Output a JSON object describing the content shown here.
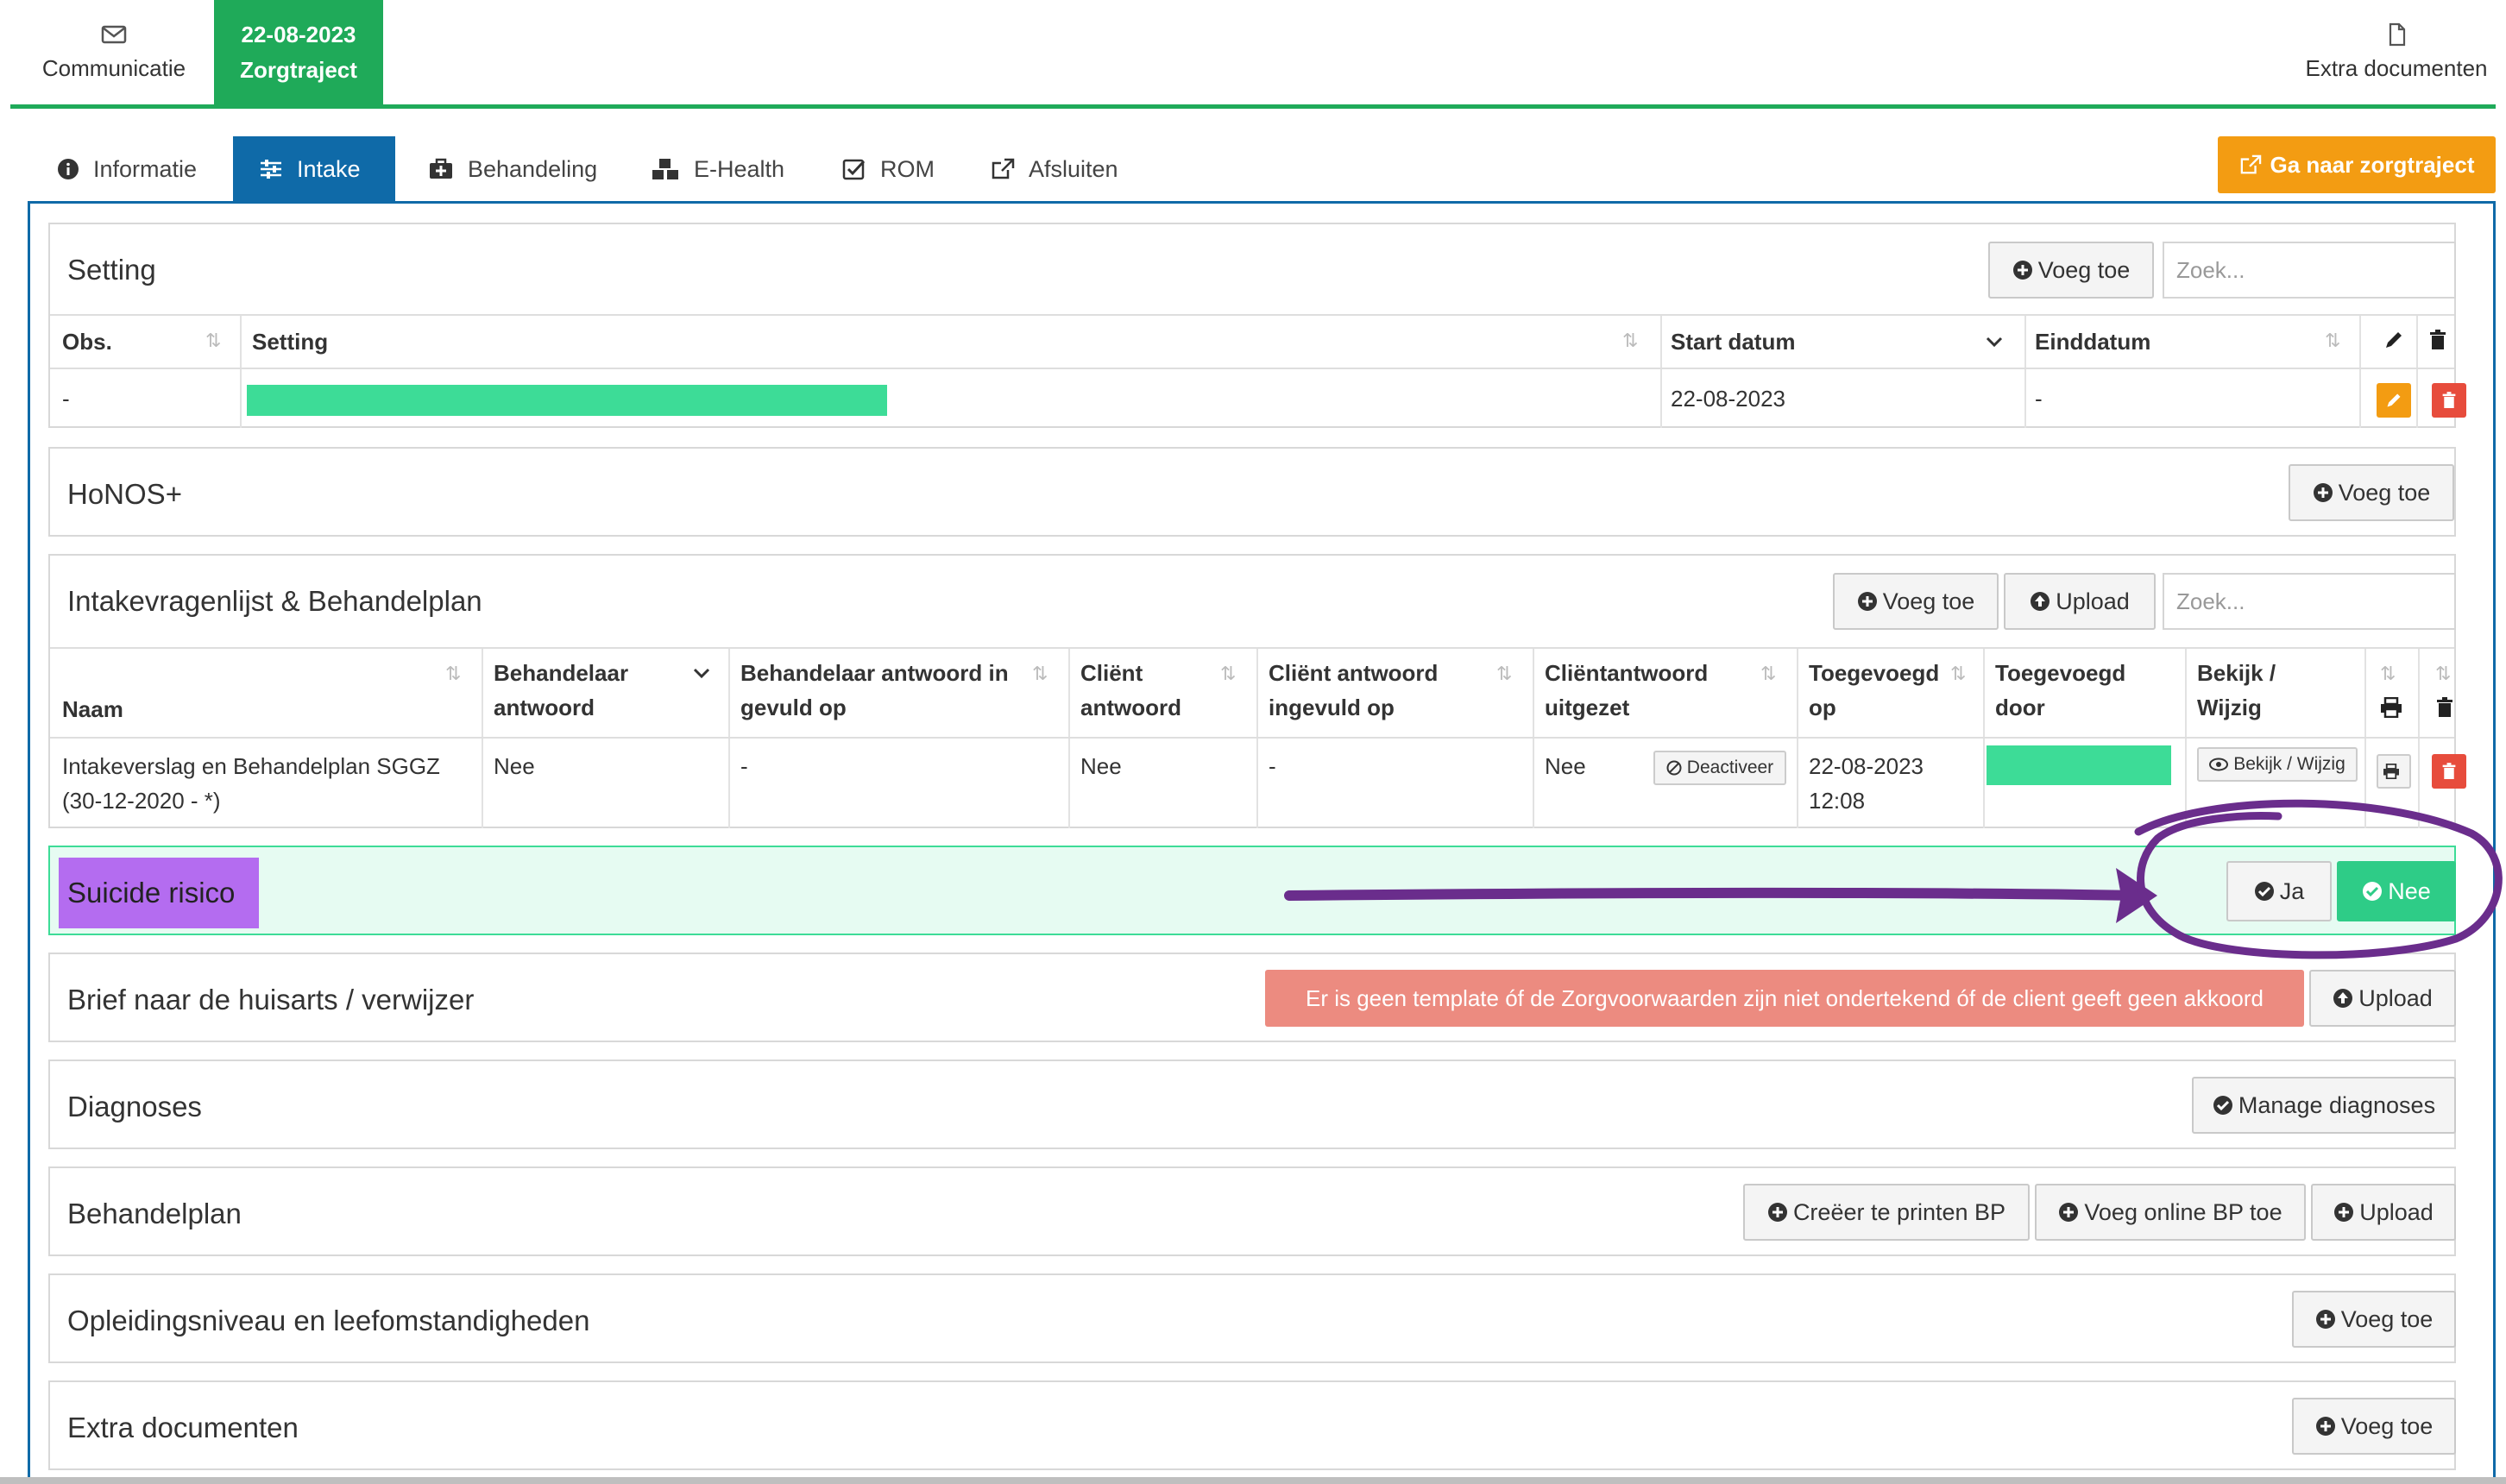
{
  "top_tabs": {
    "communicatie": "Communicatie",
    "zorgtraject_date": "22-08-2023",
    "zorgtraject": "Zorgtraject",
    "extra_documenten": "Extra documenten"
  },
  "sub_tabs": [
    {
      "label": "Informatie",
      "icon": "info-icon"
    },
    {
      "label": "Intake",
      "icon": "sliders-icon"
    },
    {
      "label": "Behandeling",
      "icon": "medkit-icon"
    },
    {
      "label": "E-Health",
      "icon": "cubes-icon"
    },
    {
      "label": "ROM",
      "icon": "check-square-icon"
    },
    {
      "label": "Afsluiten",
      "icon": "external-link-icon"
    }
  ],
  "go_button": "Ga naar zorgtraject",
  "setting": {
    "title": "Setting",
    "add": "Voeg toe",
    "search_placeholder": "Zoek...",
    "headers": [
      "Obs.",
      "Setting",
      "Start datum",
      "Einddatum"
    ],
    "row": {
      "obs": "-",
      "start": "22-08-2023",
      "end": "-"
    }
  },
  "honos": {
    "title": "HoNOS+",
    "add": "Voeg toe"
  },
  "intake": {
    "title": "Intakevragenlijst & Behandelplan",
    "add": "Voeg toe",
    "upload": "Upload",
    "search_placeholder": "Zoek...",
    "headers": {
      "naam": "Naam",
      "beh_1": "Behandelaar",
      "beh_2": "antwoord",
      "beh_op_1": "Behandelaar antwoord in",
      "beh_op_2": "gevuld op",
      "cli_1": "Cliënt",
      "cli_2": "antwoord",
      "cli_op_1": "Cliënt antwoord",
      "cli_op_2": "ingevuld op",
      "uit_1": "Cliëntantwoord",
      "uit_2": "uitgezet",
      "toe_1": "Toegevoegd",
      "toe_2": "op",
      "door_1": "Toegevoegd",
      "door_2": "door",
      "bekijk_1": "Bekijk /",
      "bekijk_2": "Wijzig"
    },
    "row": {
      "naam_1": "Intakeverslag en Behandelplan SGGZ",
      "naam_2": "(30-12-2020 - *)",
      "beh": "Nee",
      "beh_op": "-",
      "cli": "Nee",
      "cli_op": "-",
      "uit": "Nee",
      "deactiveer": "Deactiveer",
      "toe_1": "22-08-2023",
      "toe_2": "12:08",
      "bekijk": "Bekijk / Wijzig"
    }
  },
  "suicide": {
    "title": "Suicide risico",
    "ja": "Ja",
    "nee": "Nee"
  },
  "brief": {
    "title": "Brief naar de huisarts / verwijzer",
    "warning": "Er is geen template óf de Zorgvoorwaarden zijn niet ondertekend óf de client geeft geen akkoord",
    "upload": "Upload"
  },
  "diagnoses": {
    "title": "Diagnoses",
    "manage": "Manage diagnoses"
  },
  "behandelplan": {
    "title": "Behandelplan",
    "create": "Creëer te printen BP",
    "online": "Voeg online BP toe",
    "upload": "Upload"
  },
  "opleiding": {
    "title": "Opleidingsniveau en leefomstandigheden",
    "add": "Voeg toe"
  },
  "extra": {
    "title": "Extra documenten",
    "add": "Voeg toe"
  },
  "colors": {
    "brand_green": "#1faa59",
    "tab_blue": "#0f6aa8",
    "orange": "#f39c12",
    "highlight_purple": "#b46cf0",
    "annotation_purple": "#6a2d8c",
    "suicide_bg": "#e6fbf2",
    "warning": "#ec8b80"
  }
}
